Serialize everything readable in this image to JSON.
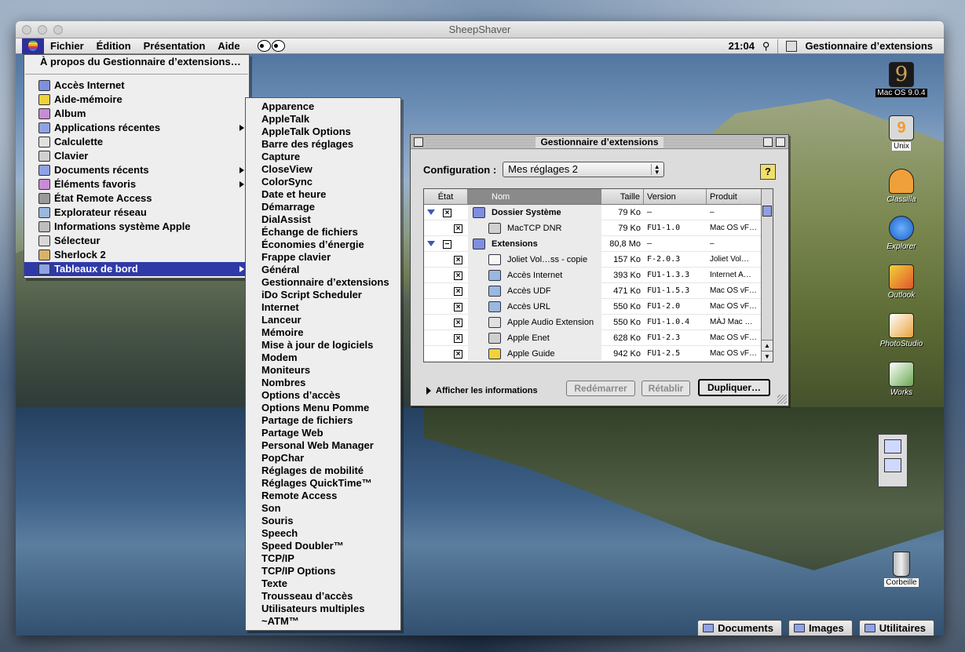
{
  "host_window": {
    "title": "SheepShaver"
  },
  "menubar": {
    "menus": [
      "Fichier",
      "Édition",
      "Présentation",
      "Aide"
    ],
    "clock": "21:04",
    "active_app": "Gestionnaire d’extensions"
  },
  "apple_menu": {
    "about": "À propos du Gestionnaire d’extensions…",
    "items": [
      {
        "label": "Accès Internet",
        "icon": "globe-icon",
        "submenu": false
      },
      {
        "label": "Aide-mémoire",
        "icon": "note-icon",
        "submenu": false
      },
      {
        "label": "Album",
        "icon": "album-icon",
        "submenu": false
      },
      {
        "label": "Applications récentes",
        "icon": "folder-icon",
        "submenu": true
      },
      {
        "label": "Calculette",
        "icon": "calculator-icon",
        "submenu": false
      },
      {
        "label": "Clavier",
        "icon": "keyboard-icon",
        "submenu": false
      },
      {
        "label": "Documents récents",
        "icon": "folder-icon",
        "submenu": true
      },
      {
        "label": "Éléments favoris",
        "icon": "folder-icon",
        "submenu": true
      },
      {
        "label": "État Remote Access",
        "icon": "phone-icon",
        "submenu": false
      },
      {
        "label": "Explorateur réseau",
        "icon": "network-icon",
        "submenu": false
      },
      {
        "label": "Informations système Apple",
        "icon": "gear-icon",
        "submenu": false
      },
      {
        "label": "Sélecteur",
        "icon": "chooser-icon",
        "submenu": false
      },
      {
        "label": "Sherlock 2",
        "icon": "magnifier-icon",
        "submenu": false
      },
      {
        "label": "Tableaux de bord",
        "icon": "folder-icon",
        "submenu": true,
        "selected": true
      }
    ]
  },
  "control_panels_submenu": [
    "Apparence",
    "AppleTalk",
    "AppleTalk Options",
    "Barre des réglages",
    "Capture",
    "CloseView",
    "ColorSync",
    "Date et heure",
    "Démarrage",
    "DialAssist",
    "Échange de fichiers",
    "Économies d’énergie",
    "Frappe clavier",
    "Général",
    "Gestionnaire d’extensions",
    "iDo Script Scheduler",
    "Internet",
    "Lanceur",
    "Mémoire",
    "Mise à jour de logiciels",
    "Modem",
    "Moniteurs",
    "Nombres",
    "Options d’accès",
    "Options Menu Pomme",
    "Partage de fichiers",
    "Partage Web",
    "Personal Web Manager",
    "PopChar",
    "Réglages de mobilité",
    "Réglages QuickTime™",
    "Remote Access",
    "Son",
    "Souris",
    "Speech",
    "Speed Doubler™",
    "TCP/IP",
    "TCP/IP Options",
    "Texte",
    "Trousseau d’accès",
    "Utilisateurs multiples",
    "~ATM™"
  ],
  "ext_manager": {
    "title": "Gestionnaire d’extensions",
    "config_label": "Configuration :",
    "config_value": "Mes réglages 2",
    "columns": {
      "etat": "État",
      "nom": "Nom",
      "taille": "Taille",
      "version": "Version",
      "produit": "Produit"
    },
    "rows": [
      {
        "type": "folder",
        "nom": "Dossier Système",
        "taille": "79 Ko",
        "version": "–",
        "produit": "–",
        "check": "☒"
      },
      {
        "type": "item",
        "nom": "MacTCP DNR",
        "taille": "79 Ko",
        "version": "FU1-1.0",
        "produit": "Mac OS vF…",
        "check": "☒"
      },
      {
        "type": "folder",
        "nom": "Extensions",
        "taille": "80,8 Mo",
        "version": "–",
        "produit": "–",
        "check": "–"
      },
      {
        "type": "item",
        "nom": "Joliet Vol…ss - copie",
        "taille": "157 Ko",
        "version": "F-2.0.3",
        "produit": "Joliet Vol…",
        "check": "☒"
      },
      {
        "type": "item",
        "nom": "Accès Internet",
        "taille": "393 Ko",
        "version": "FU1-1.3.3",
        "produit": "Internet A…",
        "check": "☒"
      },
      {
        "type": "item",
        "nom": "Accès UDF",
        "taille": "471 Ko",
        "version": "FU1-1.5.3",
        "produit": "Mac OS vF…",
        "check": "☒"
      },
      {
        "type": "item",
        "nom": "Accès URL",
        "taille": "550 Ko",
        "version": "FU1-2.0",
        "produit": "Mac OS vF…",
        "check": "☒"
      },
      {
        "type": "item",
        "nom": "Apple Audio Extension",
        "taille": "550 Ko",
        "version": "FU1-1.0.4",
        "produit": "MÀJ Mac …",
        "check": "☒"
      },
      {
        "type": "item",
        "nom": "Apple Enet",
        "taille": "628 Ko",
        "version": "FU1-2.3",
        "produit": "Mac OS vF…",
        "check": "☒"
      },
      {
        "type": "item",
        "nom": "Apple Guide",
        "taille": "942 Ko",
        "version": "FU1-2.5",
        "produit": "Mac OS vF…",
        "check": "☒"
      }
    ],
    "show_info": "Afficher les informations",
    "buttons": {
      "restart": "Redémarrer",
      "revert": "Rétablir",
      "duplicate": "Dupliquer…"
    }
  },
  "desktop_icons": [
    {
      "label": "Mac OS 9.0.4",
      "icon": "os9-disk-icon"
    },
    {
      "label": "Unix",
      "icon": "unix-disk-icon"
    },
    {
      "label": "Classilla",
      "icon": "classilla-icon"
    },
    {
      "label": "Explorer",
      "icon": "ie-icon"
    },
    {
      "label": "Outlook",
      "icon": "outlook-icon"
    },
    {
      "label": "PhotoStudio",
      "icon": "photostudio-icon"
    },
    {
      "label": "Works",
      "icon": "works-icon"
    },
    {
      "label": "Corbeille",
      "icon": "trash-icon"
    }
  ],
  "tabs": [
    "Documents",
    "Images",
    "Utilitaires"
  ],
  "colors": {
    "menu_highlight": "#2f3aa8",
    "folder_blue": "#8fa2e6"
  }
}
